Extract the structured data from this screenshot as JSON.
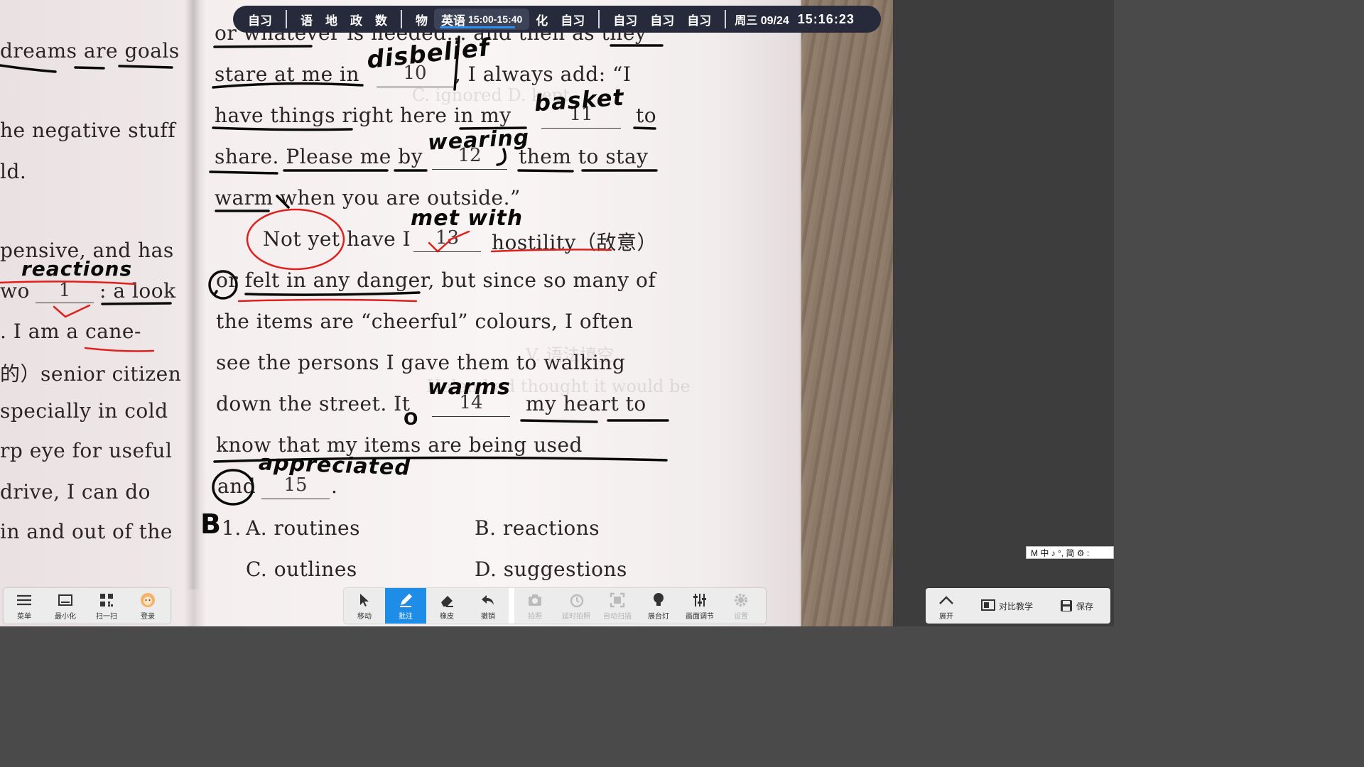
{
  "schedule": {
    "items_a": [
      "自习"
    ],
    "items_b": [
      "语",
      "地",
      "政",
      "数"
    ],
    "items_c": [
      "物"
    ],
    "current_subject": "英语",
    "current_time": "15:00-15:40",
    "items_d": [
      "化",
      "自习"
    ],
    "items_e": [
      "自习",
      "自习",
      "自习"
    ],
    "date": "周三 09/24",
    "clock": "15:16:23"
  },
  "left_toolbar": [
    {
      "label": "菜单",
      "icon": "menu-icon"
    },
    {
      "label": "最小化",
      "icon": "minimize-icon"
    },
    {
      "label": "扫一扫",
      "icon": "qr-scan-icon"
    },
    {
      "label": "登录",
      "icon": "avatar-icon"
    }
  ],
  "center_toolbar": [
    {
      "label": "移动",
      "icon": "pointer-icon",
      "state": "normal"
    },
    {
      "label": "批注",
      "icon": "pen-icon",
      "state": "active"
    },
    {
      "label": "橡皮",
      "icon": "eraser-icon",
      "state": "normal"
    },
    {
      "label": "撤销",
      "icon": "undo-icon",
      "state": "normal"
    },
    {
      "label": "拍照",
      "icon": "camera-icon",
      "state": "disabled"
    },
    {
      "label": "延时拍照",
      "icon": "timer-icon",
      "state": "disabled"
    },
    {
      "label": "自动扫描",
      "icon": "scan-icon",
      "state": "disabled"
    },
    {
      "label": "展台灯",
      "icon": "lamp-icon",
      "state": "normal"
    },
    {
      "label": "画面调节",
      "icon": "sliders-icon",
      "state": "normal"
    },
    {
      "label": "设置",
      "icon": "gear-icon",
      "state": "disabled"
    }
  ],
  "right_toolbar": [
    {
      "label": "展开",
      "icon": "chevron-up-icon"
    },
    {
      "label": "对比教学",
      "icon": "compare-icon"
    },
    {
      "label": "保存",
      "icon": "save-icon"
    }
  ],
  "ime": "M 中 ♪ °, 简 ⚙ :",
  "left_column": [
    "dreams  are  goals",
    "he negative stuff",
    "ld.",
    "pensive, and has",
    "wo",
    ": a  look",
    ".  I  am  a  cane-",
    "的）senior citizen",
    "specially  in  cold",
    "rp  eye  for  useful",
    "drive,  I  can  do",
    "  in  and  out  of  the"
  ],
  "main_text": {
    "line0": "or  whatever  is  needed...  and  then  as  they",
    "line1a": "stare  at  me  in",
    "line1b": ",  I  always  add: “I",
    "line2a": "have  things  right  here  in  my",
    "line2b": "to",
    "line3a": "share.  Please  me  by",
    "line3b": "them  to  stay",
    "line4": "warm  when  you  are  outside.”",
    "line5a": "Not  yet  have  I",
    "line5b": "hostility（敌意）",
    "line6": "or  felt  in  any  danger,  but  since  so  many  of",
    "line7": "the  items  are  “cheerful”  colours,  I  often",
    "line8": "see  the  persons  I  gave  them  to  walking",
    "line9a": "down  the  street.  It",
    "line9b": "my  heart  to",
    "line10": "know  that  my  items  are  being  used",
    "line11a": "and",
    "line11b": ".",
    "opt_num": "1.",
    "opt_a": "A.  routines",
    "opt_b": "B.  reactions",
    "opt_c": "C.  outlines",
    "opt_d": "D.  suggestions",
    "blanks": [
      "10",
      "11",
      "12",
      "13",
      "14",
      "15",
      "1"
    ]
  },
  "handwriting": {
    "disbelief": "disbelief",
    "basket": "basket",
    "wearing": "wearing",
    "met_with": "met with",
    "warms": "warms",
    "appreciated": "appreciated",
    "reactions": "reactions",
    "answer_b": "B",
    "o_mark": "O"
  },
  "colors": {
    "accent_blue": "#1e8de8",
    "schedule_bg": "#262a3a",
    "red_ink": "#e0201c"
  }
}
